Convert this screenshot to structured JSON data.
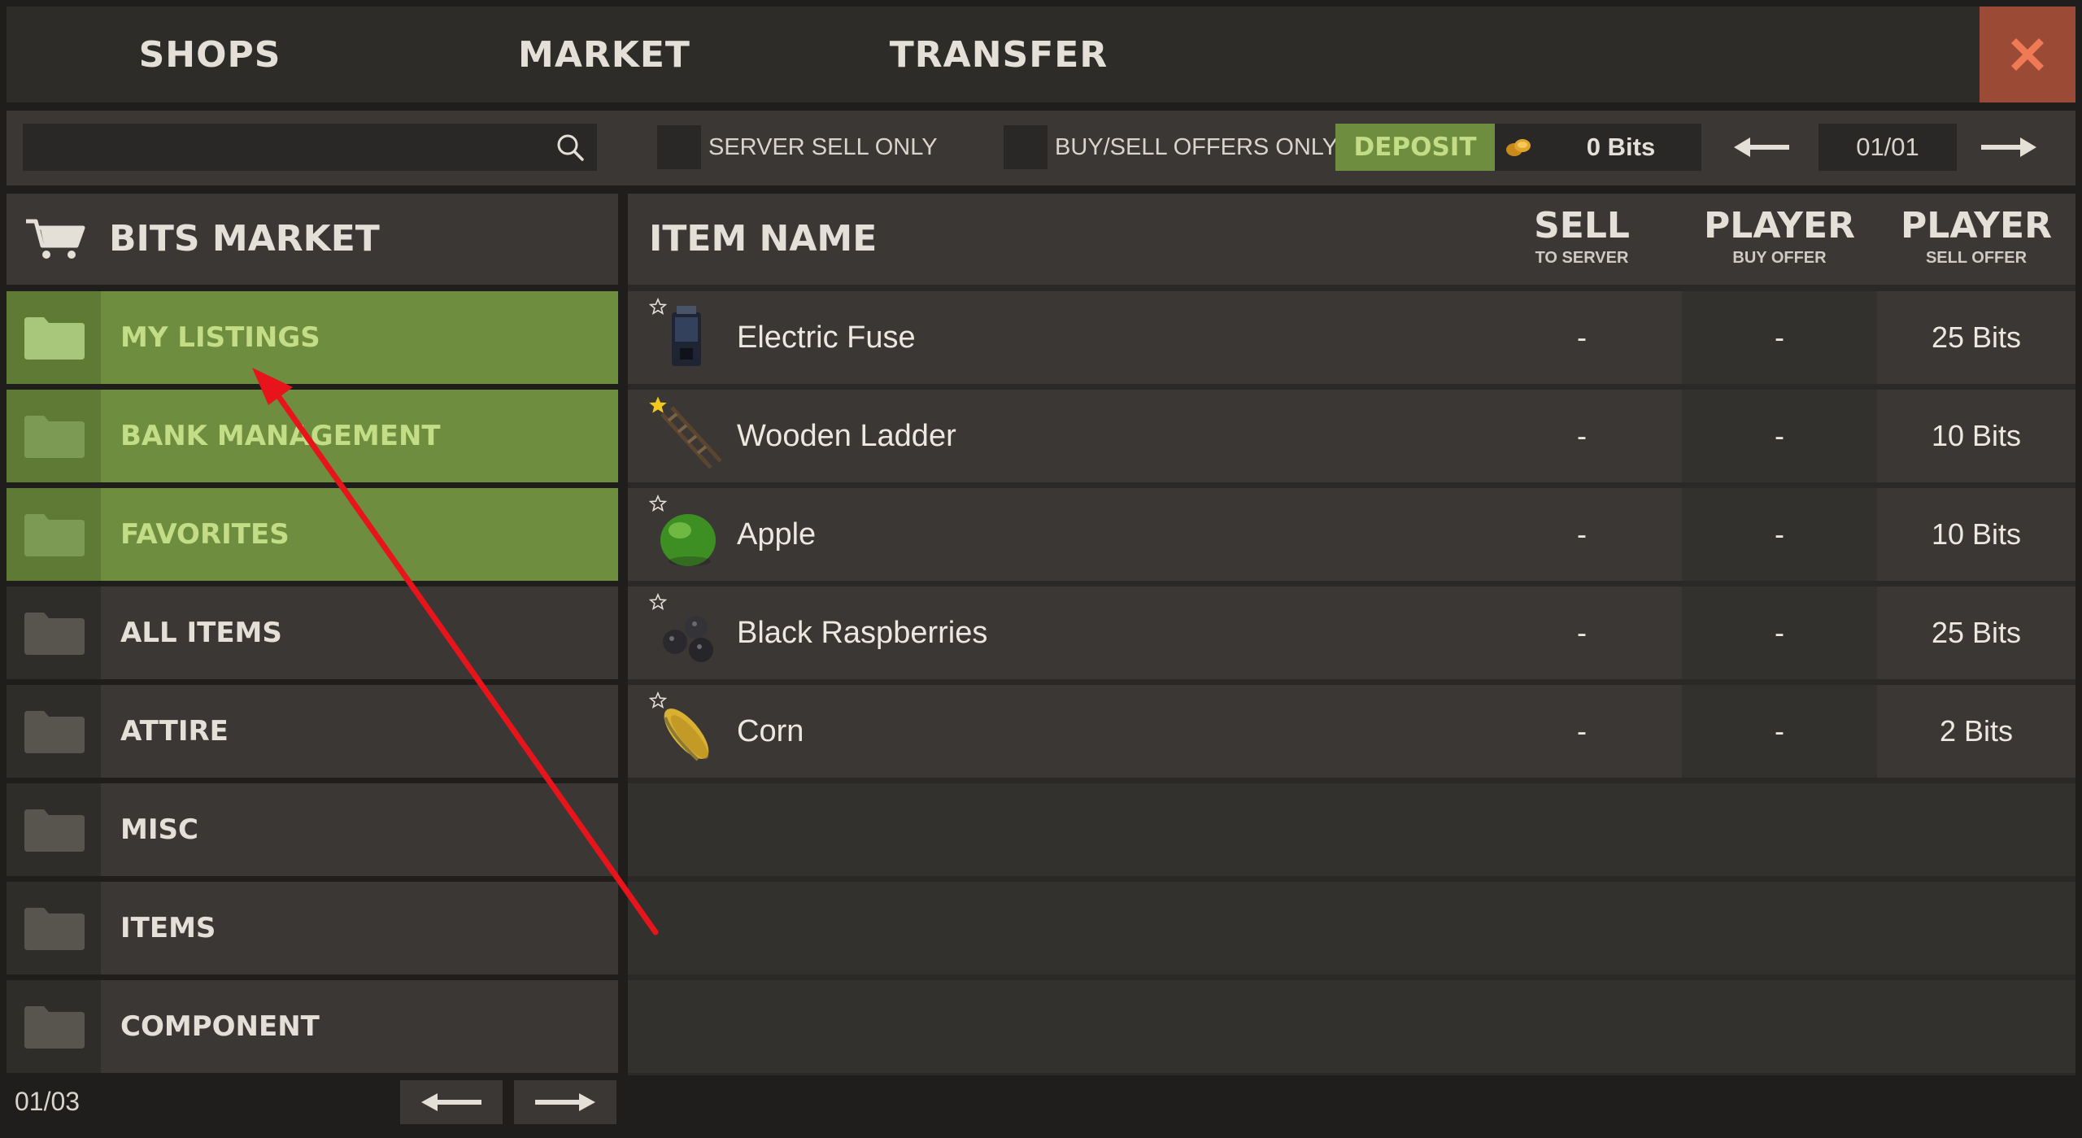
{
  "tabs": {
    "shops": "SHOPS",
    "market": "MARKET",
    "transfer": "TRANSFER"
  },
  "filters": {
    "search_placeholder": "",
    "server_sell_only": "SERVER SELL ONLY",
    "buy_sell_offers_only": "BUY/SELL OFFERS ONLY",
    "deposit": "DEPOSIT",
    "balance": "0 Bits",
    "page": "01/01"
  },
  "sidebar": {
    "title": "BITS MARKET",
    "categories": [
      {
        "label": "MY LISTINGS",
        "active": true
      },
      {
        "label": "BANK MANAGEMENT",
        "active": true
      },
      {
        "label": "FAVORITES",
        "active": true
      },
      {
        "label": "ALL ITEMS",
        "active": false
      },
      {
        "label": "ATTIRE",
        "active": false
      },
      {
        "label": "MISC",
        "active": false
      },
      {
        "label": "ITEMS",
        "active": false
      },
      {
        "label": "COMPONENT",
        "active": false
      }
    ],
    "page": "01/03"
  },
  "table": {
    "headers": {
      "item_name": "ITEM NAME",
      "sell_big": "SELL",
      "sell_small": "TO SERVER",
      "buy_big": "PLAYER",
      "buy_small": "BUY OFFER",
      "pso_big": "PLAYER",
      "pso_small": "SELL OFFER"
    },
    "rows": [
      {
        "name": "Electric Fuse",
        "icon": "fuse-icon",
        "starred": false,
        "sell_to_server": "-",
        "player_buy_offer": "-",
        "player_sell_offer": "25 Bits"
      },
      {
        "name": "Wooden Ladder",
        "icon": "ladder-icon",
        "starred": true,
        "sell_to_server": "-",
        "player_buy_offer": "-",
        "player_sell_offer": "10 Bits"
      },
      {
        "name": "Apple",
        "icon": "apple-icon",
        "starred": false,
        "sell_to_server": "-",
        "player_buy_offer": "-",
        "player_sell_offer": "10 Bits"
      },
      {
        "name": "Black Raspberries",
        "icon": "raspberries-icon",
        "starred": false,
        "sell_to_server": "-",
        "player_buy_offer": "-",
        "player_sell_offer": "25 Bits"
      },
      {
        "name": "Corn",
        "icon": "corn-icon",
        "starred": false,
        "sell_to_server": "-",
        "player_buy_offer": "-",
        "player_sell_offer": "2 Bits"
      }
    ]
  },
  "colors": {
    "accent_green": "#6f8d3e",
    "accent_green_text": "#c3dd86",
    "close_red": "#9b4a35",
    "annotation_red": "#e8141c"
  }
}
